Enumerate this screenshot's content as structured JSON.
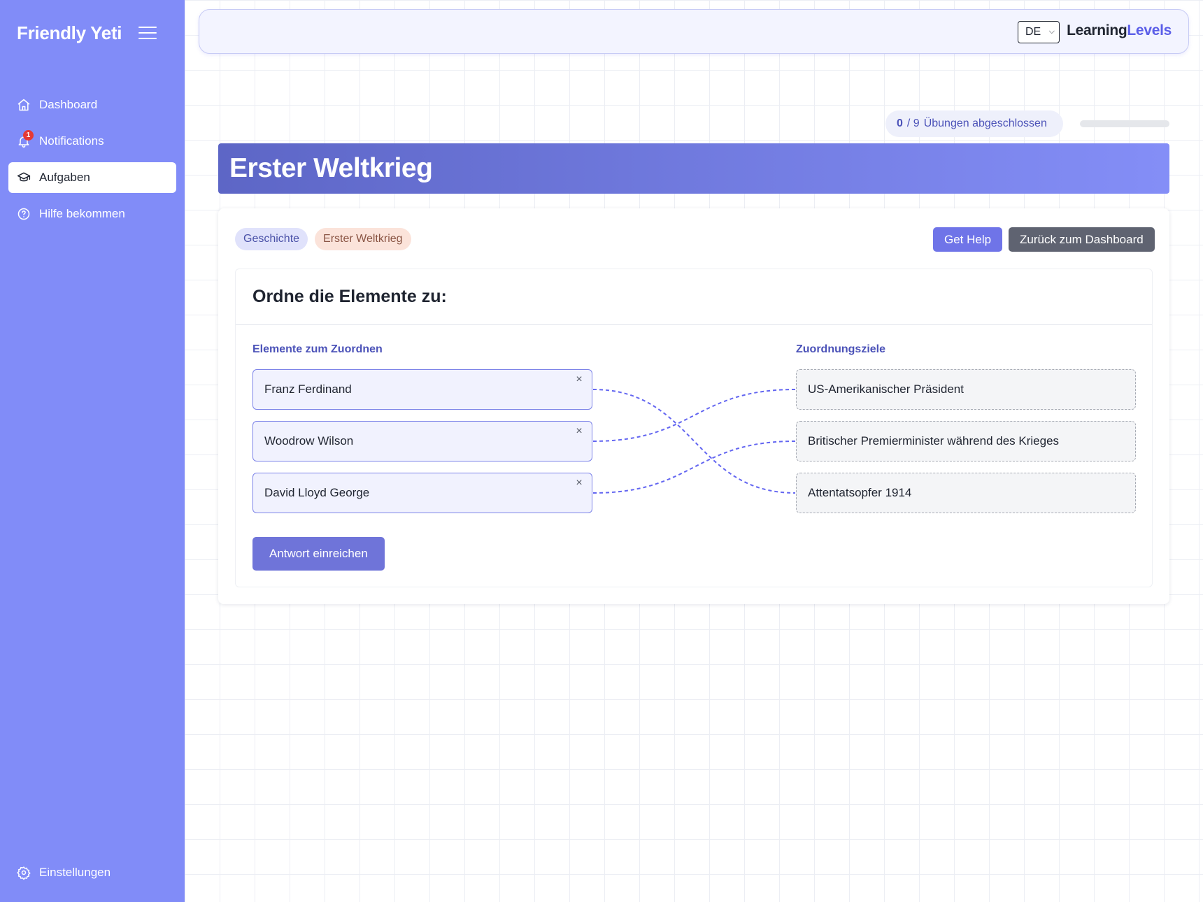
{
  "sidebar": {
    "brand": "Friendly Yeti",
    "items": [
      {
        "label": "Dashboard",
        "icon": "home-icon"
      },
      {
        "label": "Notifications",
        "icon": "bell-icon",
        "badge": "1"
      },
      {
        "label": "Aufgaben",
        "icon": "graduation-cap-icon",
        "active": true
      },
      {
        "label": "Hilfe bekommen",
        "icon": "help-circle-icon"
      }
    ],
    "settings_label": "Einstellungen"
  },
  "topbar": {
    "language": "DE",
    "logo_part1": "Learning",
    "logo_part2": "Levels"
  },
  "progress": {
    "completed": "0",
    "total_text": "/ 9",
    "label": "Übungen abgeschlossen",
    "fraction": 0
  },
  "page": {
    "title": "Erster Weltkrieg",
    "tags": {
      "subject": "Geschichte",
      "topic": "Erster Weltkrieg"
    },
    "help_button": "Get Help",
    "back_button": "Zurück zum Dashboard"
  },
  "exercise": {
    "heading": "Ordne die Elemente zu:",
    "left_label": "Elemente zum Zuordnen",
    "right_label": "Zuordnungsziele",
    "items": [
      {
        "label": "Franz Ferdinand",
        "match_index": 2
      },
      {
        "label": "Woodrow Wilson",
        "match_index": 0
      },
      {
        "label": "David Lloyd George",
        "match_index": 1
      }
    ],
    "targets": [
      {
        "label": "US-Amerikanischer Präsident"
      },
      {
        "label": "Britischer Premierminister während des Krieges"
      },
      {
        "label": "Attentatsopfer 1914"
      }
    ],
    "remove_symbol": "×",
    "submit_label": "Antwort einreichen",
    "line_color": "#6366f1"
  },
  "colors": {
    "sidebar": "#818cf8",
    "accent": "#6366f1"
  }
}
